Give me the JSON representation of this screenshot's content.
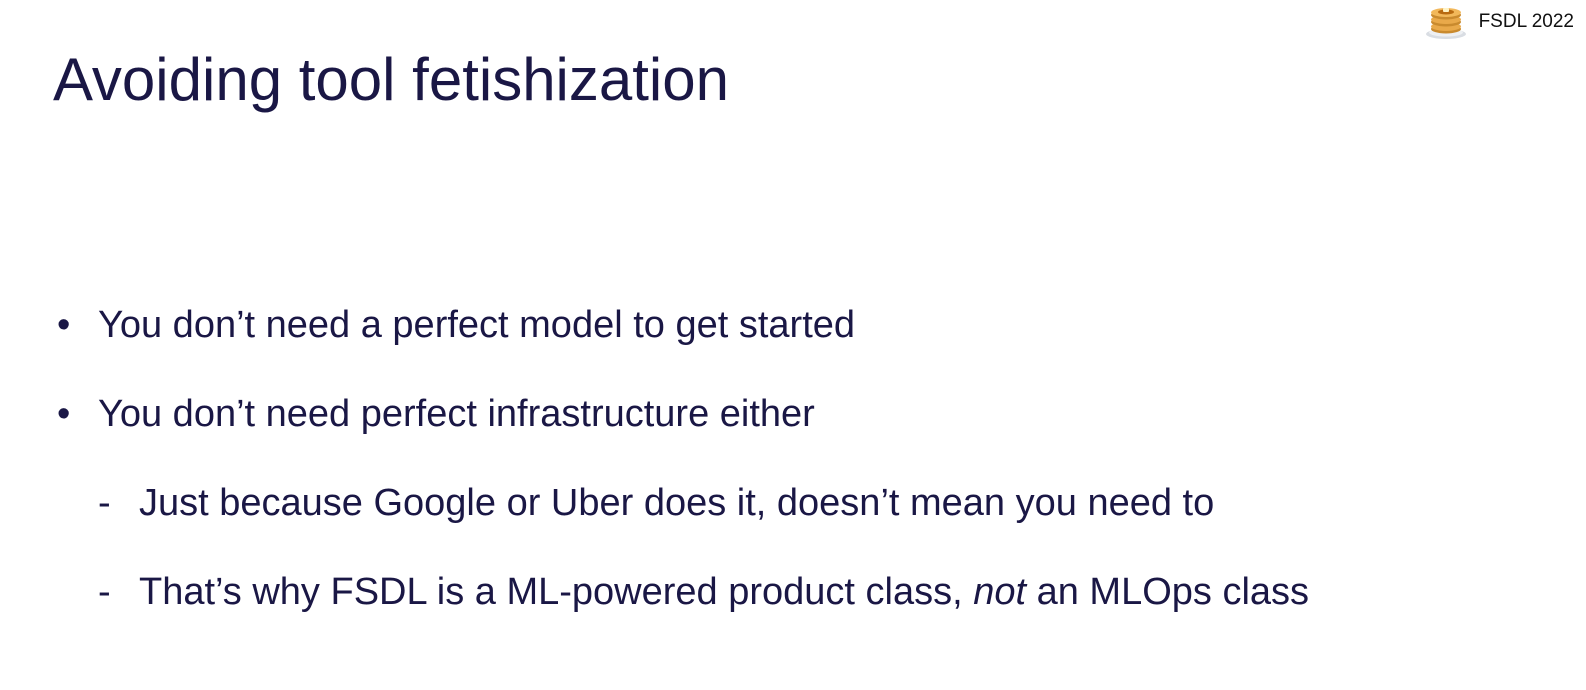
{
  "slide": {
    "title": "Avoiding tool fetishization",
    "brand": {
      "text": "FSDL 2022",
      "logo_icon": "pancake-stack-icon"
    },
    "bullets": [
      {
        "level": 1,
        "marker": "•",
        "text": "You don’t need a perfect model to get started"
      },
      {
        "level": 1,
        "marker": "•",
        "text": "You don’t need perfect infrastructure either"
      },
      {
        "level": 2,
        "marker": "-",
        "text": "Just because Google or Uber does it, doesn’t mean you need to"
      },
      {
        "level": 2,
        "marker": "-",
        "text_before": "That’s why FSDL is a ML-powered product class, ",
        "text_emphasis": "not",
        "text_after": " an MLOps class"
      }
    ]
  },
  "colors": {
    "text": "#1a1745",
    "background": "#ffffff"
  }
}
